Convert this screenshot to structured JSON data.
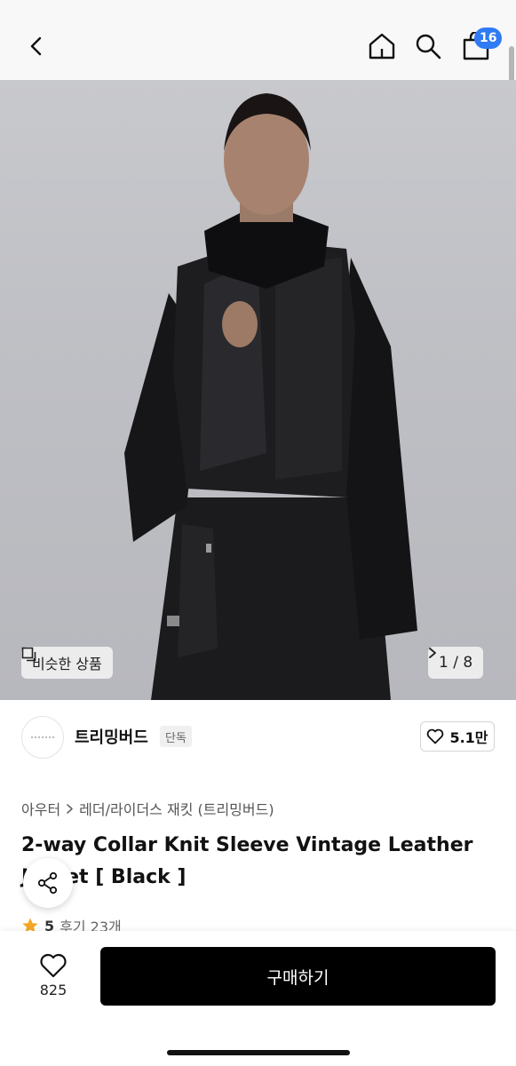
{
  "header": {
    "cart_count": "16",
    "icons": [
      "back-icon",
      "home-icon",
      "search-icon",
      "bag-icon"
    ],
    "accent": "#2f7bf5"
  },
  "gallery": {
    "similar_label": "비슷한 상품",
    "pager": "1 / 8"
  },
  "brand": {
    "name": "트리밍버드",
    "tag": "단독",
    "likes": "5.1만"
  },
  "breadcrumb": {
    "category": "아우터",
    "subcategory": "레더/라이더스 재킷 (트리밍버드)"
  },
  "product": {
    "title": "2-way Collar Knit Sleeve Vintage Leather Jacket [ Black ]",
    "rating": "5",
    "reviews": "후기 23개"
  },
  "footer": {
    "wish_count": "825",
    "buy_label": "구매하기"
  }
}
